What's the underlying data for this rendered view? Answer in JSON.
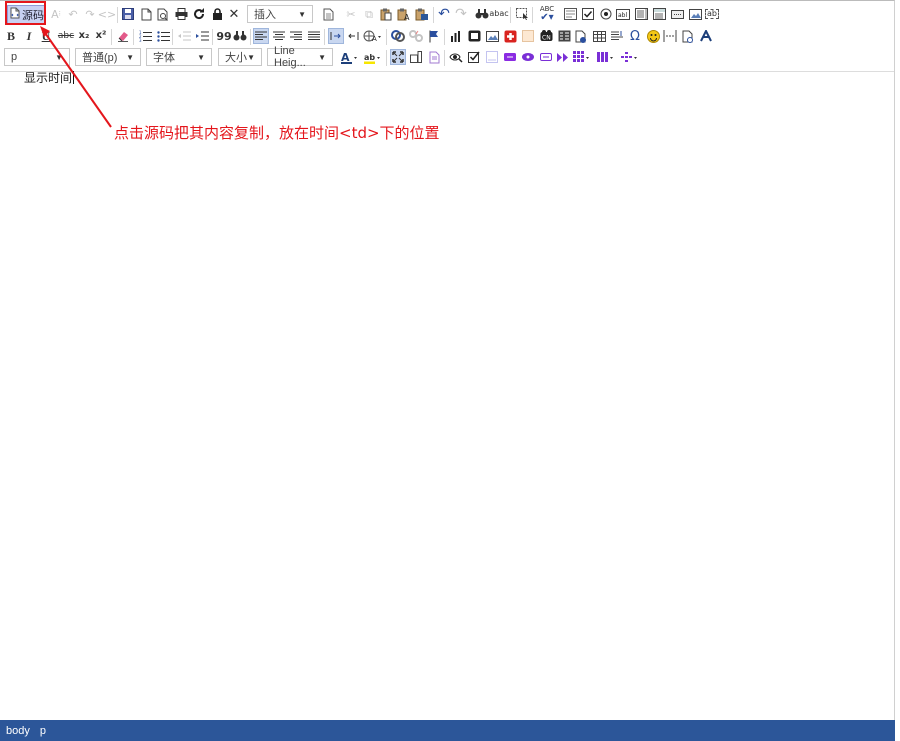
{
  "toolbar": {
    "source_label": "源码",
    "insert_select": "插入",
    "format_select": "p",
    "paragraph_select": "普通(p)",
    "font_select": "字体",
    "size_select": "大小",
    "lineheight_select": "Line Heig...",
    "bold": "B",
    "italic": "I",
    "underline": "U",
    "strike": "abc",
    "subscript": "x₂",
    "superscript": "x²",
    "quote": "99",
    "omega": "Ω",
    "replace": "abac",
    "abc_spell": "ABC",
    "abbr": "ab"
  },
  "content": {
    "text": "显示时间"
  },
  "annotation": {
    "text": "点击源码把其内容复制，放在时间<td>下的位置",
    "color": "#e4161c"
  },
  "statusbar": {
    "path": [
      "body",
      "p"
    ]
  },
  "colors": {
    "statusbar_bg": "#2c5699",
    "active_button_bg": "#c8d1f2"
  }
}
